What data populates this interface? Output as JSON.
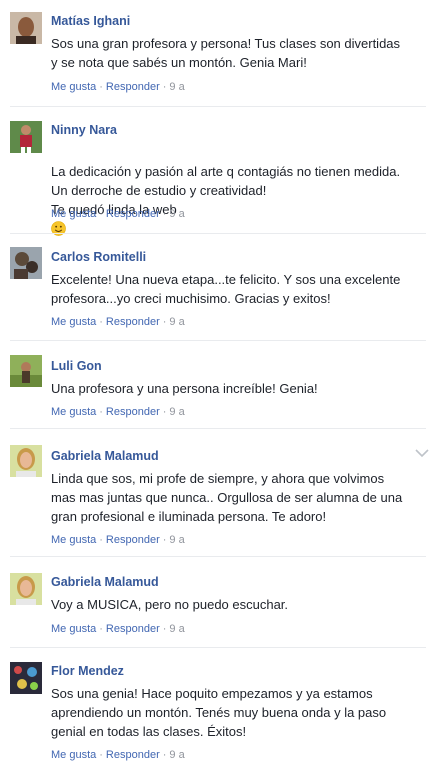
{
  "comments": [
    {
      "name": "Matías Ighani",
      "text": "Sos una gran profesora y persona! Tus clases son divertidas\ny se nota que sabés un montón. Genia Mari!",
      "like": "Me gusta",
      "reply": "Responder",
      "time": "9 a",
      "avatar_color": "#8a5a3c"
    },
    {
      "name": "Ninny Nara",
      "text": "La dedicación y pasión al arte q contagiás no tienen medida.\nUn derroche de estudio y creatividad!\nTe quedó linda la web",
      "emoji": "smile-emoji",
      "like": "Me gusta",
      "reply": "Responder",
      "time": "9 a",
      "avatar_color": "#b3263a"
    },
    {
      "name": "Carlos Romitelli",
      "text": "Excelente! Una nueva etapa...te felicito. Y sos una excelente\nprofesora...yo creci muchisimo. Gracias y exitos!",
      "like": "Me gusta",
      "reply": "Responder",
      "time": "9 a",
      "avatar_color": "#5b4a3a"
    },
    {
      "name": "Luli Gon",
      "text": "Una profesora y una persona increíble! Genia!",
      "like": "Me gusta",
      "reply": "Responder",
      "time": "9 a",
      "avatar_color": "#6a8a3a"
    },
    {
      "name": "Gabriela Malamud",
      "text": "Linda que sos, mi profe de siempre, y ahora que volvimos\nmas mas juntas que nunca.. Orgullosa de ser alumna de una\ngran profesional e iluminada persona. Te adoro!",
      "like": "Me gusta",
      "reply": "Responder",
      "time": "9 a",
      "avatar_color": "#b8c86a",
      "menu_icon": "chevron-down-icon"
    },
    {
      "name": "Gabriela Malamud",
      "text": "Voy a MUSICA, pero no puedo escuchar.",
      "like": "Me gusta",
      "reply": "Responder",
      "time": "9 a",
      "avatar_color": "#b8c86a"
    },
    {
      "name": "Flor Mendez",
      "text": "Sos una genia! Hace poquito empezamos y ya estamos\naprendiendo un montón. Tenés muy buena onda y la paso\ngenial en todas las clases. Éxitos!",
      "like": "Me gusta",
      "reply": "Responder",
      "time": "9 a",
      "avatar_color": "#7a5c8a"
    }
  ],
  "separator_dot": "·"
}
